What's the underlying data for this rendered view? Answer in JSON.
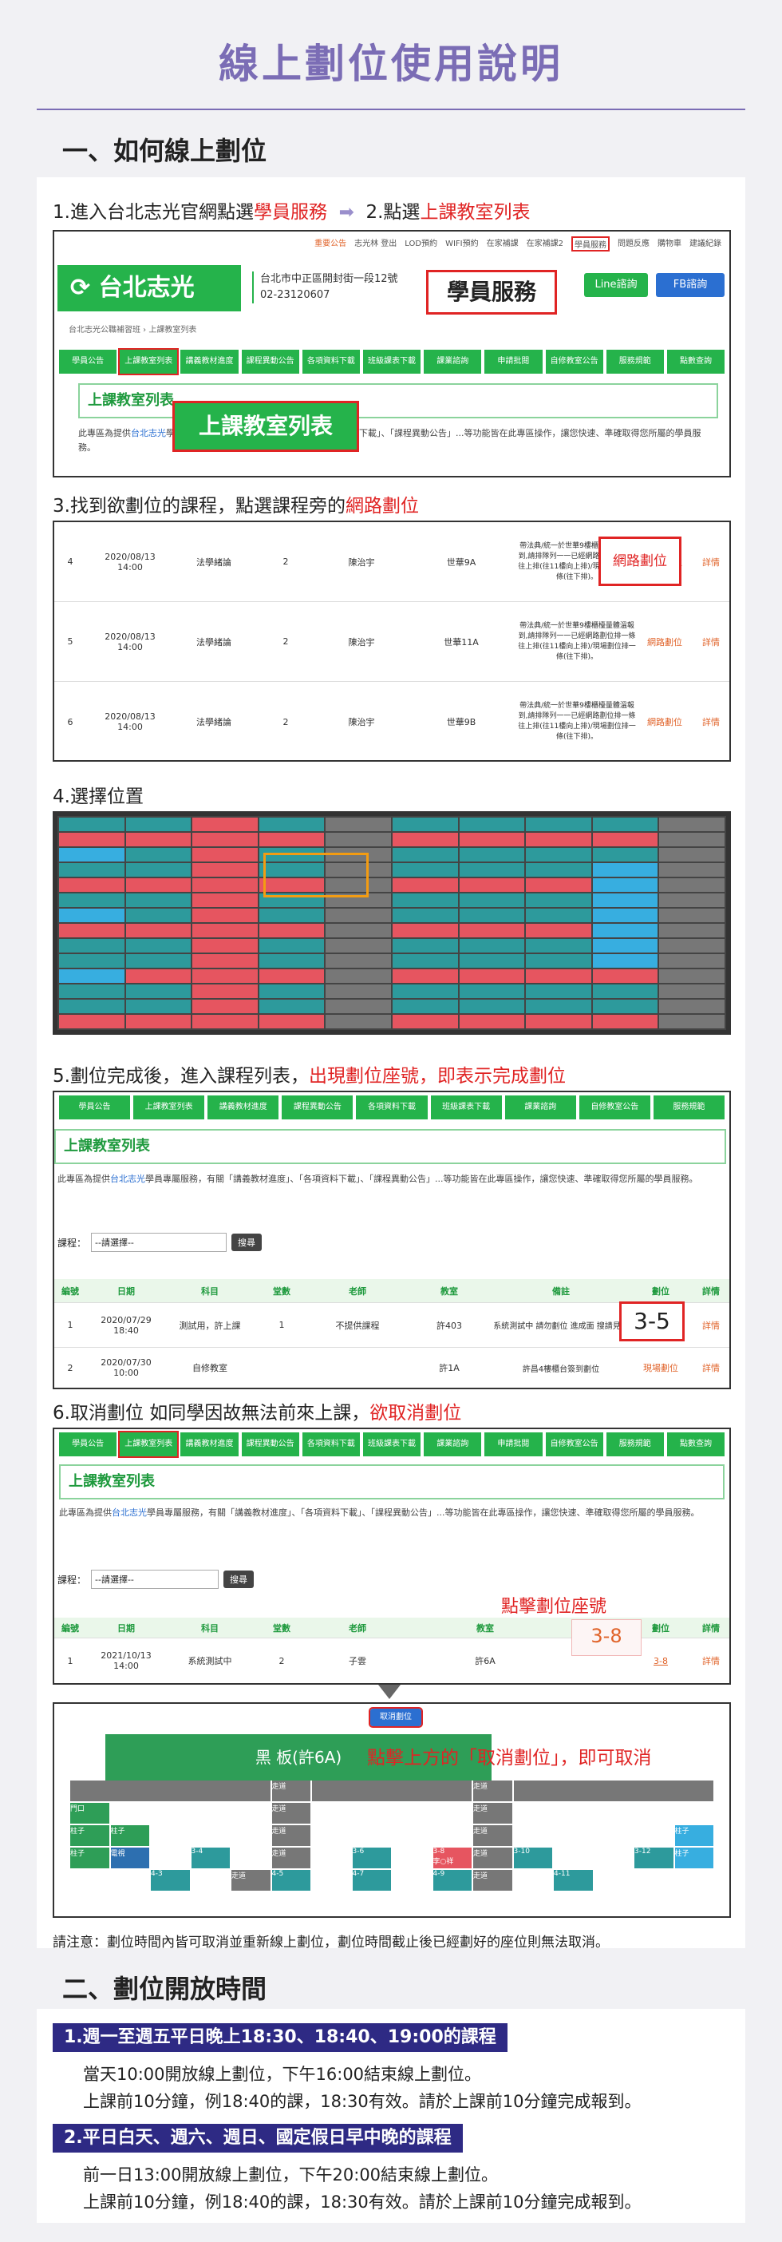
{
  "page_title": "線上劃位使用說明",
  "section1": {
    "heading": "一、如何線上劃位",
    "step1_a": "1.進入台北志光官網點選",
    "step1_b": "學員服務",
    "step1_c": "2.點選",
    "step1_d": "上課教室列表",
    "step3_a": "3.找到欲劃位的課程，點選課程旁的",
    "step3_b": "網路劃位",
    "step4": "4.選擇位置",
    "step5_a": "5.劃位完成後，進入課程列表，",
    "step5_b": "出現劃位座號，即表示完成劃位",
    "step6_a": "6.取消劃位 如同學因故無法前來上課，",
    "step6_b": "欲取消劃位",
    "note": "請注意：劃位時間內皆可取消並重新線上劃位，劃位時間截止後已經劃好的座位則無法取消。"
  },
  "site": {
    "logo": "台北志光",
    "address": "台北市中正區開封街一段12號",
    "phone": "02-23120607",
    "topbar": [
      "重要公告",
      "志光林 登出",
      "LOD預約",
      "WIFI預約",
      "在家補課",
      "在家補課2",
      "學員服務",
      "問題反應",
      "購物車",
      "建議紀錄"
    ],
    "line_btn": "Line諮詢",
    "fb_btn": "FB諮詢",
    "breadcrumb": "台北志光公職補習班 › 上課教室列表",
    "nav": [
      "學員公告",
      "上課教室列表",
      "講義教材進度",
      "課程異動公告",
      "各項資料下載",
      "班級課表下載",
      "課業諮詢",
      "申請批閱",
      "自修教室公告",
      "服務規範",
      "點數查詢"
    ],
    "callout_service": "學員服務",
    "callout_list": "上課教室列表",
    "list_title": "上課教室列表",
    "notice_prefix": "此專區為提供",
    "notice_brand": "台北志光",
    "notice_text": "學員專屬服務，有關「講義教材進度」、「各項資料下載」、「課程異動公告」...等功能皆在此專區操作，讓您快速、準確取得您所屬的學員服務。",
    "course_label": "課程：",
    "select_value": "--請選擇--",
    "search_btn": "搜尋"
  },
  "step3_rows": [
    {
      "no": "4",
      "date": "2020/08/13",
      "time": "14:00",
      "subject": "法學緒論",
      "hall": "2",
      "teacher": "陳治宇",
      "room": "世華9A",
      "memo": "帶法典/統一於世華9樓櫃檯量體溫報到,請排隊列一一已經網路劃位排一條 往上排(往11樓向上排)/現場劃位排一條(往下排)。",
      "seat": "網路劃位",
      "detail": "詳情"
    },
    {
      "no": "5",
      "date": "2020/08/13",
      "time": "14:00",
      "subject": "法學緒論",
      "hall": "2",
      "teacher": "陳治宇",
      "room": "世華11A",
      "memo": "帶法典/統一於世華9樓櫃檯量體溫報到,請排隊列一一已經網路劃位排一條 往上排(往11樓向上排)/現場劃位排一條(往下排)。",
      "seat": "網路劃位",
      "detail": "詳情"
    },
    {
      "no": "6",
      "date": "2020/08/13",
      "time": "14:00",
      "subject": "法學緒論",
      "hall": "2",
      "teacher": "陳治宇",
      "room": "世華9B",
      "memo": "帶法典/統一於世華9樓櫃檯量體溫報到,請排隊列一一已經網路劃位排一條 往上排(往11樓向上排)/現場劃位排一條(往下排)。",
      "seat": "網路劃位",
      "detail": "詳情"
    }
  ],
  "step5": {
    "headers": [
      "編號",
      "日期",
      "科目",
      "堂數",
      "老師",
      "教室",
      "備註",
      "劃位",
      "詳情"
    ],
    "rows": [
      {
        "no": "1",
        "date": "2020/07/29",
        "time": "18:40",
        "subject": "測試用，許上課",
        "hall": "1",
        "teacher": "不提供課程",
        "room": "許403",
        "memo": "系統測試中 請勿劃位 進成面 搜請見諒",
        "seat": "3-5",
        "detail": "詳情"
      },
      {
        "no": "2",
        "date": "2020/07/30",
        "time": "10:00",
        "subject": "自修教室",
        "hall": "",
        "teacher": "",
        "room": "許1A",
        "memo": "許昌4樓櫃台簽到劃位",
        "seat": "現場劃位",
        "detail": "詳情"
      }
    ],
    "callout_seat": "3-5"
  },
  "step6": {
    "callout_click": "點擊劃位座號",
    "callout_seat": "3-8",
    "row": {
      "no": "1",
      "date": "2021/10/13",
      "time": "14:00",
      "subject": "系統測試中",
      "hall": "2",
      "teacher": "子雲",
      "room": "許6A",
      "seat": "3-8",
      "detail": "詳情"
    },
    "cancel_btn": "取消劃位",
    "board": "黑 板(許6A)",
    "board_note": "點擊上方的「取消劃位」，即可取消",
    "walkway": "走道",
    "door": "門口",
    "pillar": "柱子",
    "tv": "電視",
    "my_seat": "3-8",
    "my_name": "李○祥",
    "seat_labels": [
      "3-4",
      "3-6",
      "3-10",
      "3-12",
      "4-3",
      "4-5",
      "4-7",
      "4-9",
      "4-11"
    ]
  },
  "section2": {
    "heading": "二、劃位開放時間",
    "bar1": "1.週一至週五平日晚上18:30、18:40、19:00的課程",
    "line1a": "當天10:00開放線上劃位，下午16:00結束線上劃位。",
    "line1b": "上課前10分鐘，例18:40的課，18:30有效。請於上課前10分鐘完成報到。",
    "bar2": "2.平日白天、週六、週日、國定假日早中晚的課程",
    "line2a": "前一日13:00開放線上劃位，下午20:00結束線上劃位。",
    "line2b": "上課前10分鐘，例18:40的課，18:30有效。請於上課前10分鐘完成報到。"
  },
  "colors": {
    "accent": "#7b6db5",
    "green": "#25b34b",
    "red": "#e02424",
    "navy": "#2e2a84"
  }
}
